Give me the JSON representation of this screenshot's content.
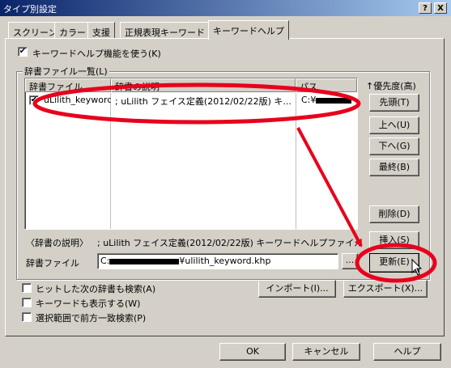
{
  "window": {
    "title": "タイプ別設定",
    "help_btn": "?",
    "close_btn": "X"
  },
  "tabs": [
    "スクリーン",
    "カラー",
    "支援",
    "正規表現キーワード",
    "キーワードヘルプ"
  ],
  "main": {
    "use_keyword_help": "キーワードヘルプ機能を使う(K)",
    "dict_list_group": "辞書ファイル一覧(L)",
    "columns": [
      "辞書ファイル",
      "辞書の説明",
      "パス"
    ],
    "rows": [
      {
        "file": "uLilith_keyword...",
        "desc": "; uLilith フェイス定義(2012/02/22版) キ...",
        "path": "C:¥"
      }
    ],
    "priority_label": "↑優先度(高)",
    "side_buttons": [
      "先頭(T)",
      "上へ(U)",
      "下へ(G)",
      "最終(B)",
      "削除(D)",
      "挿入(S)",
      "更新(E)"
    ],
    "desc_label": "〈辞書の説明〉",
    "desc_value": "; uLilith フェイス定義(2012/02/22版) キーワードヘルプファイル",
    "dict_file_label": "辞書ファイル",
    "dict_file_prefix": "C:",
    "dict_file_value": "¥ulilith_keyword.khp",
    "browse_label": "...",
    "opt_search_next": "ヒットした次の辞書も検索(A)",
    "opt_show_keyword": "キーワードも表示する(W)",
    "opt_prefix_match": "選択範囲で前方一致検索(P)",
    "import_label": "インポート(I)...",
    "export_label": "エクスポート(X)..."
  },
  "footer": {
    "ok": "OK",
    "cancel": "キャンセル",
    "help": "ヘルプ"
  },
  "colors": {
    "annotation": "#e8001c",
    "title_from": "#0a246a",
    "title_to": "#a6caf0"
  }
}
